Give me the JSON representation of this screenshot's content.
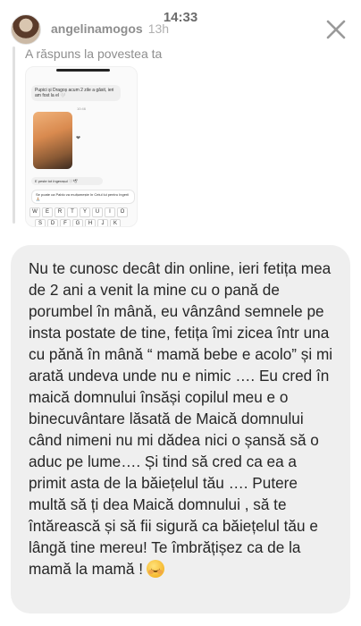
{
  "status": {
    "time": "14:33"
  },
  "header": {
    "username": "angelinamogos",
    "time_ago": "13h",
    "close_icon": "close-icon"
  },
  "reply": {
    "label": "A răspuns la povestea ta"
  },
  "story_thumbnail": {
    "bubble_text": "Pupici și Dragoș acum 2 zile a găsit, ieri am fost la el 🤍",
    "time_label": "10:46",
    "caption": "E peste tot îngerașul 🤍🕊",
    "input_text": "Se poate ca Pablo va mulțumește în Ceiul lui pentru îngerii 🙏🏼",
    "keyboard_row1": [
      "W",
      "E",
      "R",
      "T",
      "Y",
      "U",
      "I",
      "O"
    ],
    "keyboard_row2": [
      "S",
      "D",
      "F",
      "G",
      "H",
      "J",
      "K"
    ]
  },
  "message": {
    "text": "Nu te cunosc decât din online, ieri fetița mea de 2 ani a venit la mine cu o pană de porumbel în mână, eu vânzând semnele pe insta postate de tine, fetița îmi zicea într una cu pănă în mână “ mamă bebe e acolo” și mi arată undeva unde nu e nimic …. Eu cred în maică domnului însăși copilul meu e o binecuvântare lăsată de Maică domnului când nimeni nu mi dădea nici o șansă să o aduc pe lume…. Și tind să cred ca ea a primit asta de la băiețelul tău …. Putere multă să ți dea Maică domnului , să te întărească și să fii sigură ca băiețelul tău e lângă tine mereu! Te îmbrățișez ca de la mamă la mamă !",
    "emoji": "blushing-smile-emoji"
  }
}
